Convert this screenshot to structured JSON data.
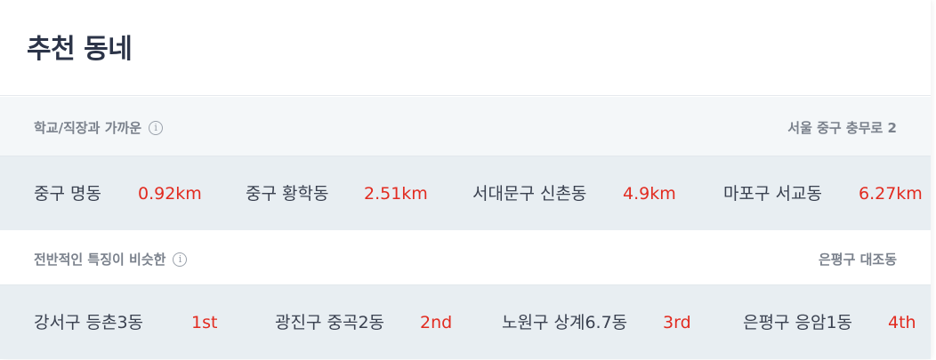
{
  "title": "추천 동네",
  "section1": {
    "label": "학교/직장과 가까운",
    "info_icon": "info-icon",
    "location": "서울 중구 충무로 2",
    "items": [
      {
        "name": "중구 명동",
        "value": "0.92km"
      },
      {
        "name": "중구 황학동",
        "value": "2.51km"
      },
      {
        "name": "서대문구 신촌동",
        "value": "4.9km"
      },
      {
        "name": "마포구 서교동",
        "value": "6.27km"
      }
    ]
  },
  "section2": {
    "label": "전반적인 특징이 비슷한",
    "info_icon": "info-icon",
    "location": "은평구 대조동",
    "items": [
      {
        "name": "강서구 등촌3동",
        "value": "1st"
      },
      {
        "name": "광진구 중곡2동",
        "value": "2nd"
      },
      {
        "name": "노원구 상계6.7동",
        "value": "3rd"
      },
      {
        "name": "은평구 응암1동",
        "value": "4th"
      }
    ]
  },
  "colors": {
    "accent": "#e22b20",
    "title": "#2c3448",
    "muted": "#7a818c",
    "row_bg": "#e8eef2",
    "head_bg": "#f4f7f9"
  }
}
